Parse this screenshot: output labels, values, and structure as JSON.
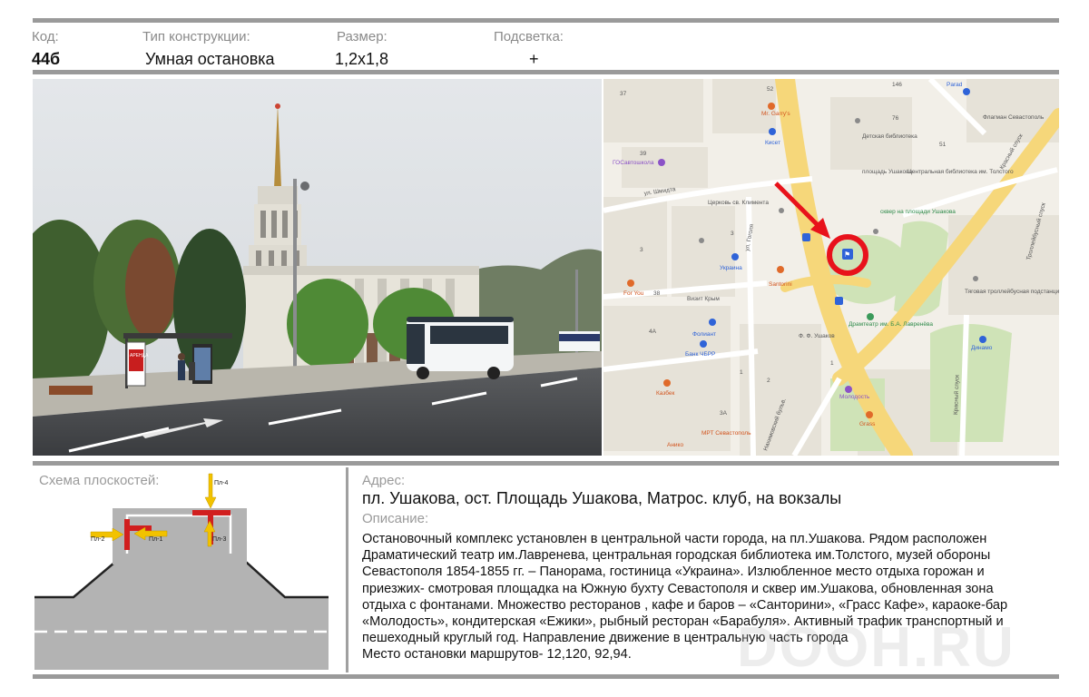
{
  "header": {
    "code_label": "Код:",
    "code_value": "44б",
    "type_label": "Тип конструкции:",
    "type_value": "Умная остановка",
    "size_label": "Размер:",
    "size_value": "1,2х1,8",
    "light_label": "Подсветка:",
    "light_value": "+"
  },
  "bus": {
    "side_sign": "АРЕНДА"
  },
  "map": {
    "labels": [
      "37",
      "52",
      "Mr. Garry's",
      "Кисет",
      "Детская библиотека",
      "76",
      "Parad",
      "Флагман Севастополь",
      "39",
      "ГОСавтошкола",
      "площадь Ушакова",
      "Центральная библиотека им. Толстого",
      "51",
      "ул. Шмидта",
      "Церковь св. Климента",
      "сквер на площади Ушакова",
      "Красный спуск",
      "Троллейбусный спуск",
      "ул. Гоголя",
      "3",
      "3",
      "Украина",
      "Santorini",
      "For You",
      "38",
      "Визит Крым",
      "Тяговая троллейбусная подстанция",
      "4А",
      "Фолиант",
      "Ф. Ф. Ушаков",
      "Драмтеатр им. Б.А. Лавренёва",
      "Банк ЧБРР",
      "Динамо",
      "Молодость",
      "Казбек",
      "3А",
      "МРТ Севастополь",
      "Grass",
      "Анико",
      "Нахимовский бульв.",
      "Красный спуск",
      "1",
      "1",
      "2",
      "146"
    ]
  },
  "scheme": {
    "label": "Схема плоскостей:",
    "planes": [
      "Пл-4",
      "Пл-2",
      "Пл-1",
      "Пл-3"
    ]
  },
  "address": {
    "label": "Адрес:",
    "value": "пл. Ушакова, ост. Площадь Ушакова, Матрос. клуб, на вокзалы"
  },
  "description": {
    "label": "Описание:",
    "lines": [
      "Остановочный комплекс  установлен в центральной части  города, на пл.Ушакова. Рядом расположен",
      "Драматический театр им.Лавренева,  центральная городская библиотека им.Толстого, музей обороны",
      "Севастополя 1854-1855 гг. – Панорама, гостиница «Украина». Излюбленное место отдыха горожан и",
      "приезжих- смотровая площадка на Южную бухту Севастополя и сквер им.Ушакова, обновленная зона",
      "отдыха с фонтанами. Множество ресторанов , кафе и баров – «Санторини», «Грасс Кафе», караоке-бар",
      "«Молодость», кондитерская «Ежики»,  рыбный ресторан «Барабуля». Активный трафик транспортный и",
      "пешеходный круглый год. Направление движение в центральную  часть города",
      "Место остановки маршрутов- 12,120, 92,94."
    ]
  },
  "watermark": "DOOH.RU",
  "colors": {
    "rule": "#9a9a9a",
    "plane_red": "#d11f1f",
    "arrow_yellow": "#f2c200",
    "map_marker": "#e8121b"
  }
}
